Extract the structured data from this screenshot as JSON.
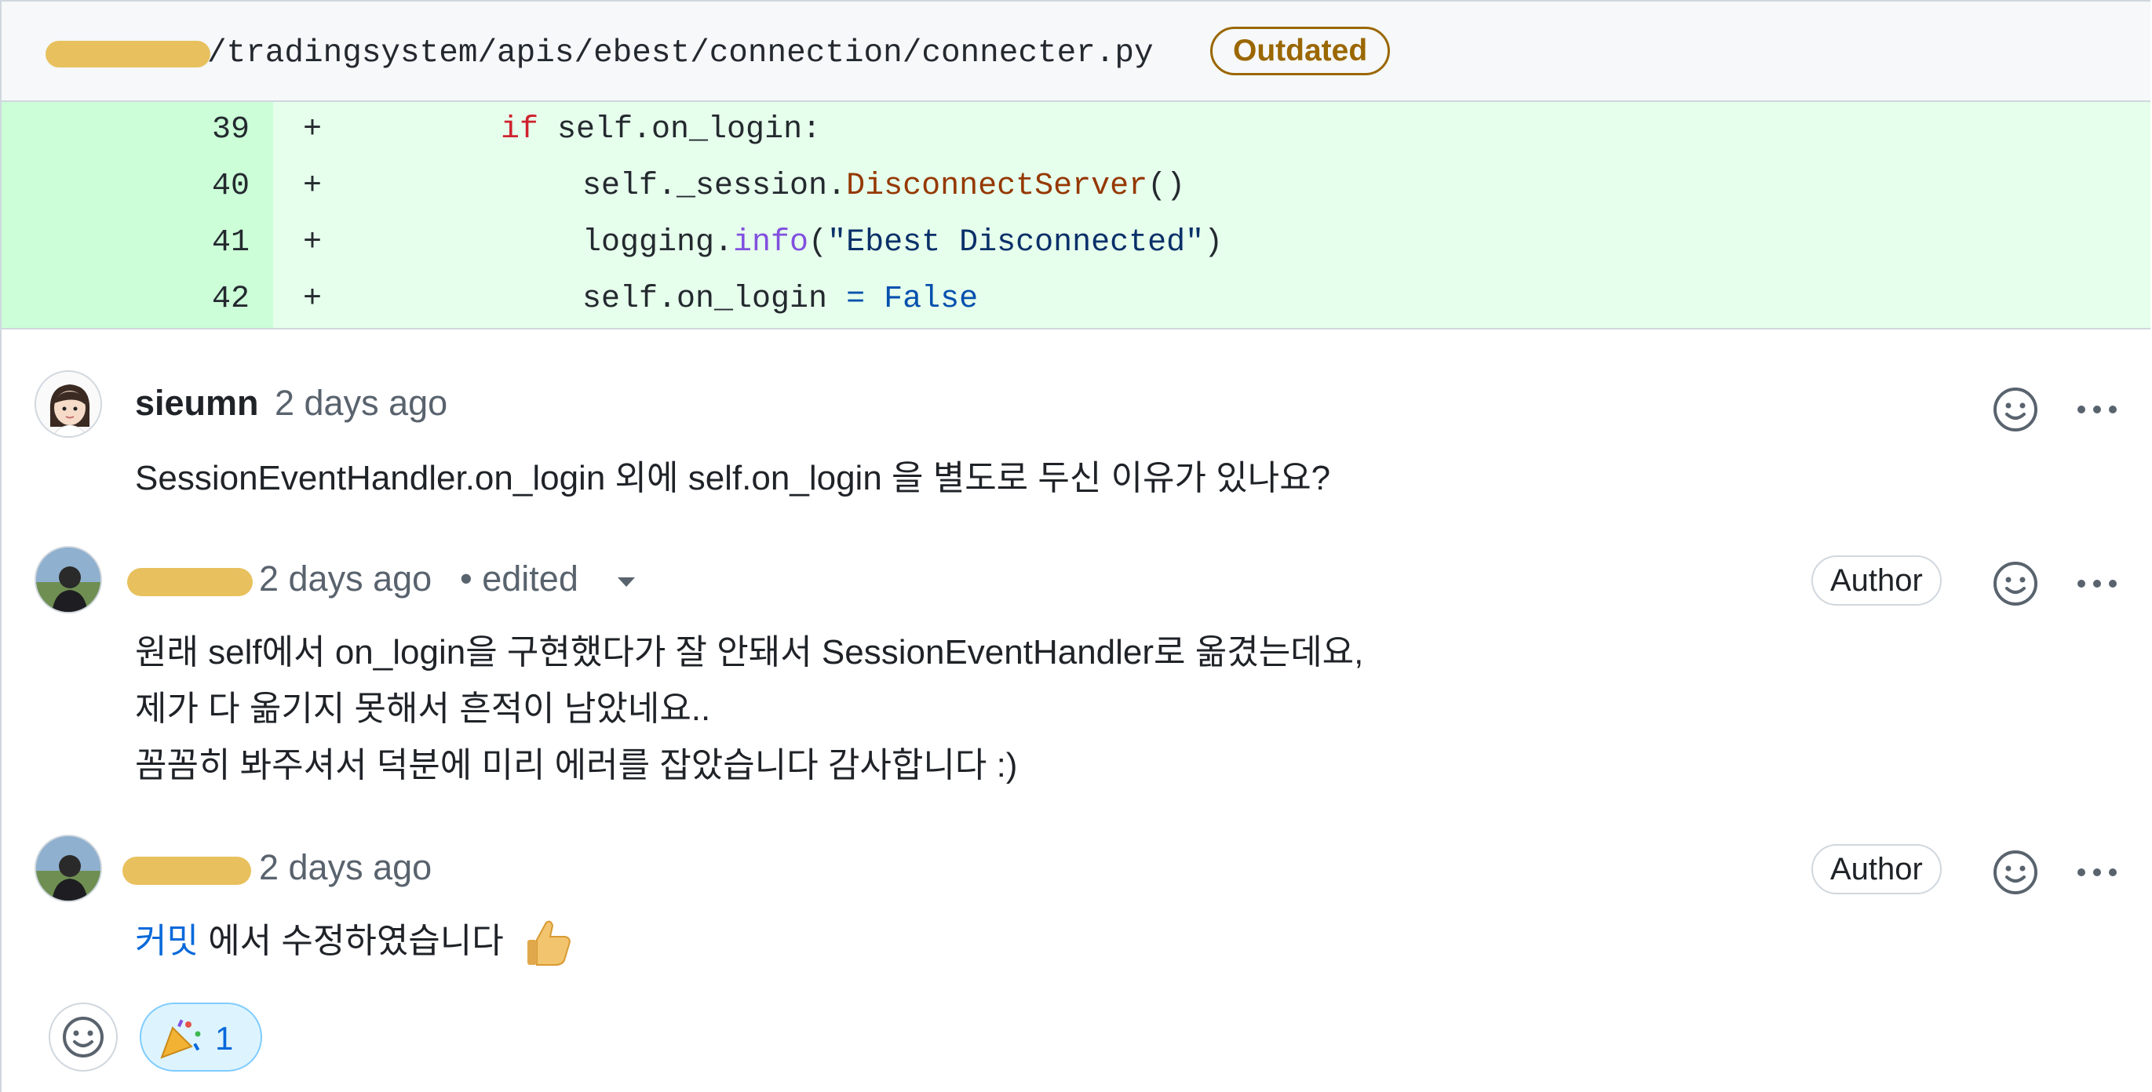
{
  "file": {
    "path": "/tradingsystem/apis/ebest/connection/connecter.py",
    "badge": "Outdated"
  },
  "diff": {
    "lines": [
      {
        "num": "39",
        "sign": "+",
        "t1": "if",
        "t2": " self.on_login:"
      },
      {
        "num": "40",
        "sign": "+",
        "t1": "self._session.",
        "t2": "DisconnectServer",
        "t3": "()"
      },
      {
        "num": "41",
        "sign": "+",
        "t1": "logging.",
        "t2": "info",
        "t3": "(",
        "t4": "\"Ebest Disconnected\"",
        "t5": ")"
      },
      {
        "num": "42",
        "sign": "+",
        "t1": "self.on_login ",
        "t2": "=",
        "t3": " ",
        "t4": "False"
      }
    ]
  },
  "comments": [
    {
      "author": "sieumn",
      "time": "2 days ago",
      "body": [
        "SessionEventHandler.on_login 외에 self.on_login 을 별도로 두신 이유가 있나요?"
      ]
    },
    {
      "time": "2 days ago",
      "edited": "• edited",
      "badge": "Author",
      "body": [
        "원래 self에서 on_login을 구현했다가 잘 안돼서 SessionEventHandler로 옮겼는데요,",
        "제가 다 옮기지 못해서 흔적이 남았네요..",
        "꼼꼼히 봐주셔서 덕분에 미리 에러를 잡았습니다 감사합니다 :)"
      ]
    },
    {
      "time": "2 days ago",
      "badge": "Author",
      "link": "커밋",
      "body_rest": " 에서 수정하였습니다"
    }
  ],
  "reactions": {
    "party_count": "1"
  },
  "colors": {
    "added_bg": "#e6ffec",
    "added_gutter": "#ccffd8",
    "outdated": "#9a6700",
    "link": "#0969da",
    "redaction": "#e8c15e"
  },
  "icons": [
    "smiley-icon",
    "kebab-horizontal-icon",
    "triangle-down-icon",
    "thumbs-up-icon",
    "party-popper-icon"
  ]
}
